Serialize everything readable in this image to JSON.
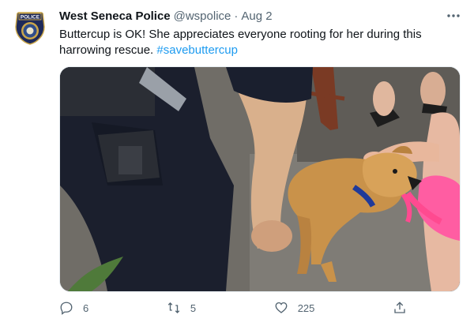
{
  "tweet": {
    "author_name": "West Seneca Police",
    "handle": "@wspolice",
    "separator": "·",
    "date": "Aug 2",
    "text": "Buttercup is OK!  She appreciates everyone rooting for her during this harrowing rescue. ",
    "hashtag": "#savebuttercup",
    "avatar": {
      "badge_text": "POLICE"
    }
  },
  "actions": {
    "reply_count": "6",
    "retweet_count": "5",
    "like_count": "225"
  },
  "colors": {
    "text": "#0f1419",
    "secondary": "#536471",
    "link": "#1d9bf0"
  },
  "icons": [
    "more-icon",
    "reply-icon",
    "retweet-icon",
    "like-icon",
    "share-icon"
  ]
}
